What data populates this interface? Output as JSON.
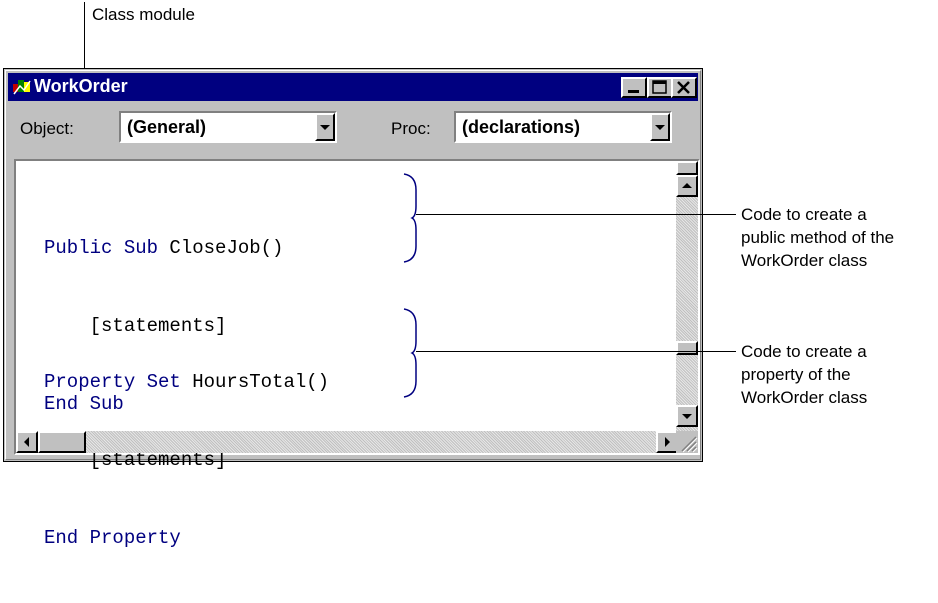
{
  "callouts": {
    "class_module": "Class module",
    "method_note": [
      "Code to create a",
      "public method of the",
      "WorkOrder class"
    ],
    "property_note": [
      "Code to create a",
      "property of the",
      "WorkOrder class"
    ]
  },
  "window": {
    "title": "WorkOrder",
    "object_label": "Object:",
    "object_value": "(General)",
    "proc_label": "Proc:",
    "proc_value": "(declarations)"
  },
  "code": {
    "method": {
      "kw1": "Public Sub",
      "name1": " CloseJob()",
      "body": "    [statements]",
      "end": "End Sub"
    },
    "property": {
      "kw1": "Property Set",
      "name1": " HoursTotal()",
      "body": "    [statements]",
      "end": "End Property"
    }
  },
  "icons": {
    "app": "vb-class-module-icon",
    "minimize": "minimize-icon",
    "maximize": "maximize-icon",
    "close": "close-icon"
  },
  "colors": {
    "titlebar": "#000080",
    "keyword": "#000080",
    "chrome": "#c0c0c0"
  }
}
